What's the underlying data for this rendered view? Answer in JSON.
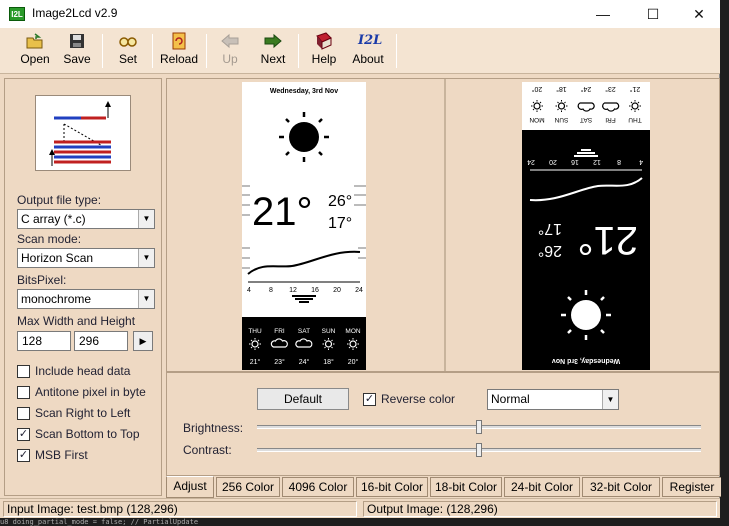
{
  "window": {
    "title": "Image2Lcd v2.9",
    "app_icon_text": "I2L",
    "controls": {
      "minimize": "—",
      "maximize": "☐",
      "close": "✕"
    }
  },
  "toolbar": {
    "open": "Open",
    "save": "Save",
    "set": "Set",
    "reload": "Reload",
    "up": "Up",
    "next": "Next",
    "help": "Help",
    "about": "About",
    "about_icon_text": "I2L"
  },
  "left": {
    "output_file_type_label": "Output file type:",
    "output_file_type_value": "C array (*.c)",
    "scan_mode_label": "Scan mode:",
    "scan_mode_value": "Horizon Scan",
    "bits_pixel_label": "BitsPixel:",
    "bits_pixel_value": "monochrome",
    "max_size_label": "Max Width and Height",
    "max_width": "128",
    "max_height": "296",
    "options": [
      {
        "label": "Include head data",
        "checked": false
      },
      {
        "label": "Antitone pixel in byte",
        "checked": false
      },
      {
        "label": "Scan Right to Left",
        "checked": false
      },
      {
        "label": "Scan Bottom to Top",
        "checked": true
      },
      {
        "label": "MSB First",
        "checked": true
      }
    ]
  },
  "input_image": {
    "date": "Wednesday, 3rd Nov",
    "temp_main": "21°",
    "temp_high": "26°",
    "temp_low": "17°",
    "hours": [
      "4",
      "8",
      "12",
      "16",
      "20",
      "24"
    ],
    "days": [
      "THU",
      "FRI",
      "SAT",
      "SUN",
      "MON"
    ],
    "day_temps": [
      "21°",
      "23°",
      "24°",
      "18°",
      "20°"
    ]
  },
  "output_image": {
    "temp_main": "21°",
    "temp_high": "26°",
    "temp_low": "17°",
    "hours": [
      "4",
      "8",
      "12",
      "16",
      "20",
      "24"
    ],
    "days": [
      "THU",
      "FRI",
      "SAT",
      "SUN",
      "MON"
    ],
    "day_temps": [
      "21°",
      "23°",
      "24°",
      "18°",
      "20°"
    ],
    "date": "Wednesday, 3rd Nov"
  },
  "adjust": {
    "default_button": "Default",
    "reverse_color_label": "Reverse color",
    "reverse_color_checked": true,
    "mode_value": "Normal",
    "brightness_label": "Brightness:",
    "contrast_label": "Contrast:",
    "brightness_level": 0.5,
    "contrast_level": 0.5
  },
  "tabs": [
    "Adjust",
    "256 Color",
    "4096 Color",
    "16-bit Color",
    "18-bit Color",
    "24-bit Color",
    "32-bit Color",
    "Register"
  ],
  "status": {
    "input": "Input Image: test.bmp (128,296)",
    "output": "Output Image: (128,296)"
  },
  "background_code": "     u8    doing_partial_mode = false;  // PartialUpdate",
  "colors": {
    "window_bg": "#eed9c3",
    "toolbar_bg": "#f4e4d2",
    "title_bg": "#ffffff"
  }
}
